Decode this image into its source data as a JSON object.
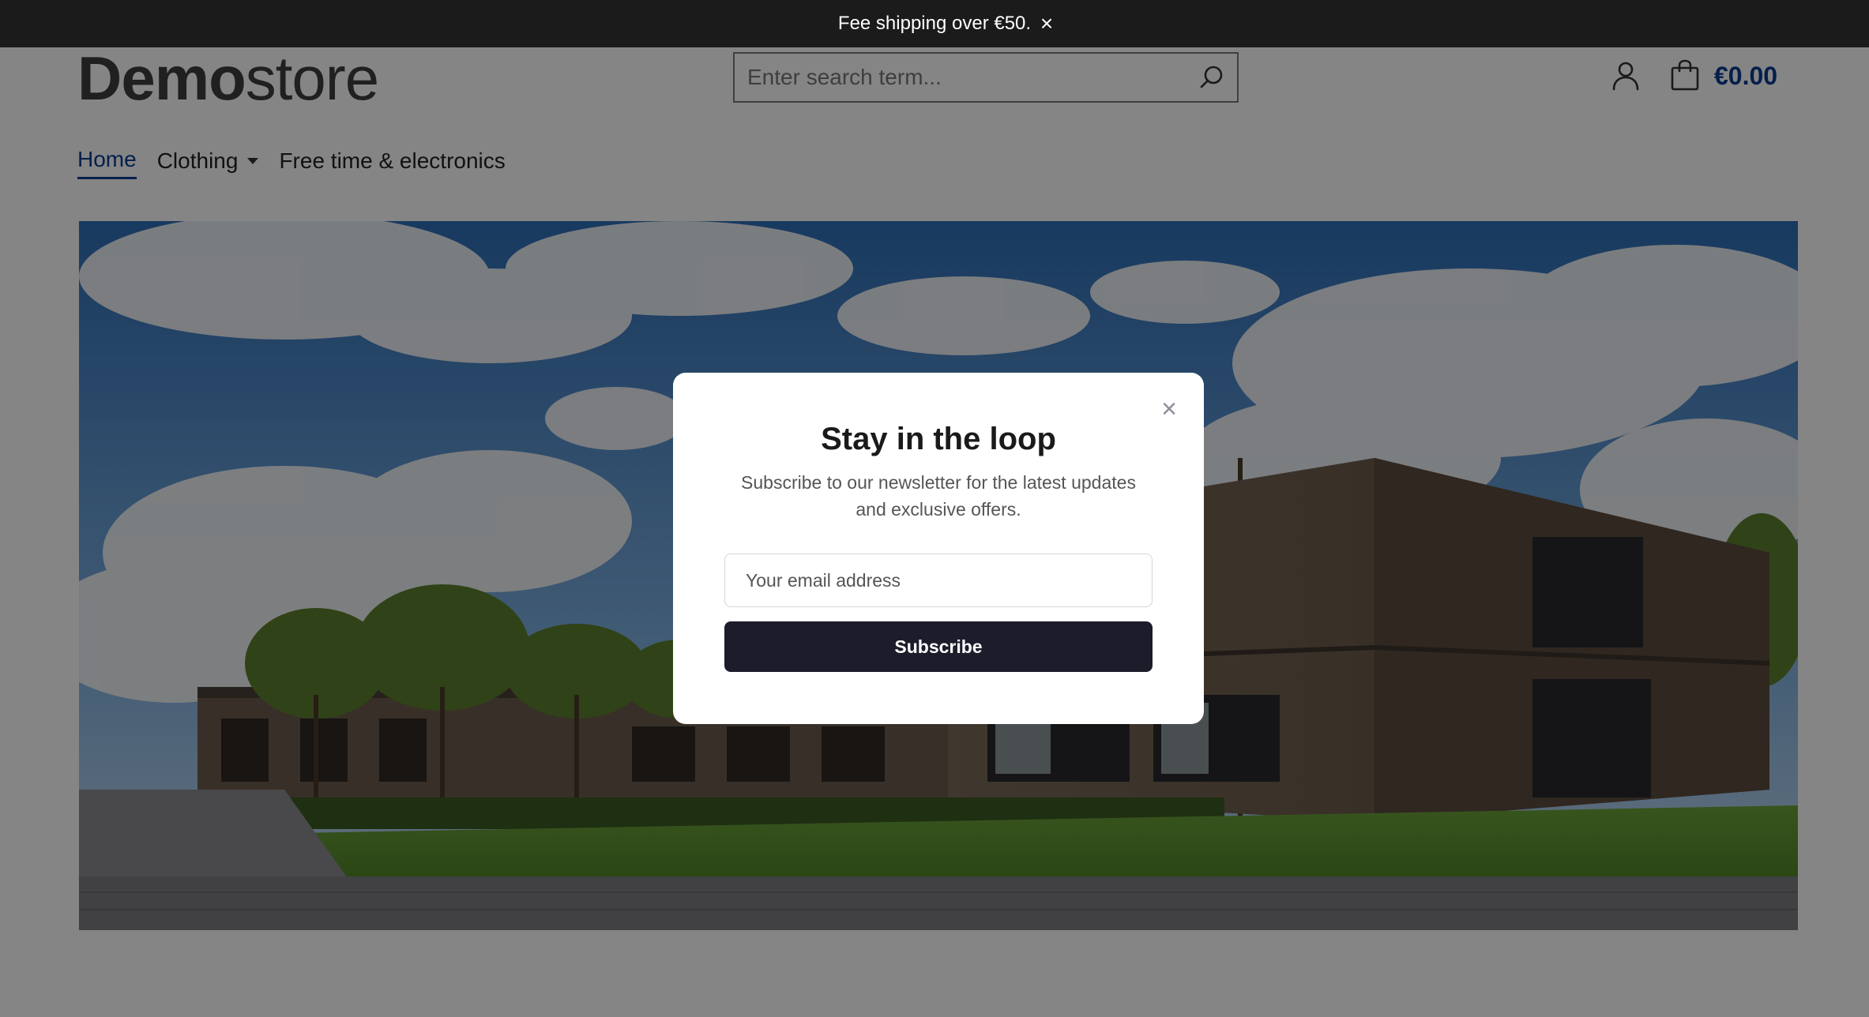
{
  "topbar": {
    "message": "Fee shipping over €50.",
    "close_symbol": "×"
  },
  "header": {
    "logo_bold": "Demo",
    "logo_light": "store",
    "search_placeholder": "Enter search term...",
    "search_icon": "search-icon",
    "account_icon": "user-icon",
    "cart_icon": "shopping-bag-icon",
    "cart_total": "€0.00",
    "accent_color": "#0b3d91"
  },
  "nav": {
    "items": [
      {
        "label": "Home",
        "active": true
      },
      {
        "label": "Clothing",
        "has_dropdown": true
      },
      {
        "label": "Free time & electronics"
      }
    ]
  },
  "modal": {
    "close_symbol": "×",
    "title": "Stay in the loop",
    "subtitle": "Subscribe to our newsletter for the latest updates and exclusive offers.",
    "email_placeholder": "Your email address",
    "subscribe_label": "Subscribe",
    "button_color": "#1c1c2b"
  }
}
